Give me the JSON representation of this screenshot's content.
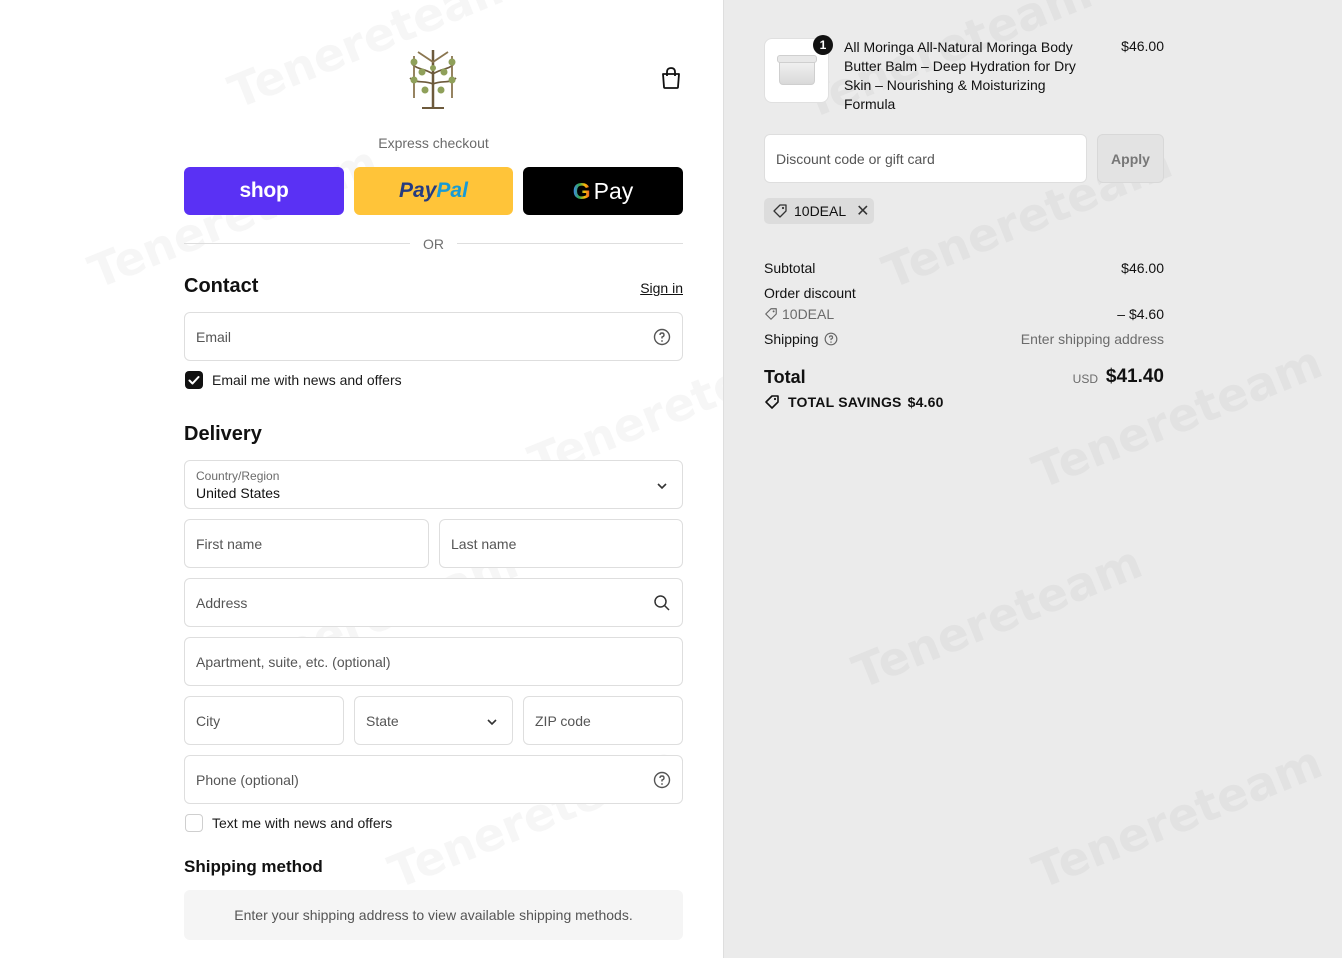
{
  "header": {
    "logo": "leaf-tree-logo",
    "cart_icon": "shopping-bag-icon"
  },
  "express": {
    "label": "Express checkout",
    "shop_label": "shop",
    "paypal_part1": "Pay",
    "paypal_part2": "Pal",
    "gpay_g": "G",
    "gpay_label": "Pay",
    "or_label": "OR"
  },
  "contact": {
    "title": "Contact",
    "signin": "Sign in",
    "email_placeholder": "Email",
    "news_label": "Email me with news and offers",
    "news_checked": true
  },
  "delivery": {
    "title": "Delivery",
    "country_label": "Country/Region",
    "country_value": "United States",
    "first_name": "First name",
    "last_name": "Last name",
    "address": "Address",
    "apartment": "Apartment, suite, etc. (optional)",
    "city": "City",
    "state": "State",
    "zip": "ZIP code",
    "phone": "Phone (optional)",
    "text_label": "Text me with news and offers",
    "text_checked": false
  },
  "shipping_method": {
    "title": "Shipping method",
    "message": "Enter your shipping address to view available shipping methods."
  },
  "order": {
    "quantity": "1",
    "product_name": "All Moringa All-Natural Moringa Body Butter Balm – Deep Hydration for Dry Skin – Nourishing & Moisturizing Formula",
    "product_price": "$46.00",
    "discount_placeholder": "Discount code or gift card",
    "apply_label": "Apply",
    "applied_code": "10DEAL",
    "subtotal_label": "Subtotal",
    "subtotal_value": "$46.00",
    "order_discount_label": "Order discount",
    "discount_code": "10DEAL",
    "discount_value": "– $4.60",
    "shipping_label": "Shipping",
    "shipping_value": "Enter shipping address",
    "total_label": "Total",
    "currency": "USD",
    "total_value": "$41.40",
    "savings_label": "TOTAL SAVINGS",
    "savings_value": "$4.60"
  },
  "watermark": "Tenereteam",
  "colors": {
    "shop": "#5a31f4",
    "paypal": "#ffc439",
    "gpay": "#000000",
    "right_bg": "#ebebeb"
  }
}
